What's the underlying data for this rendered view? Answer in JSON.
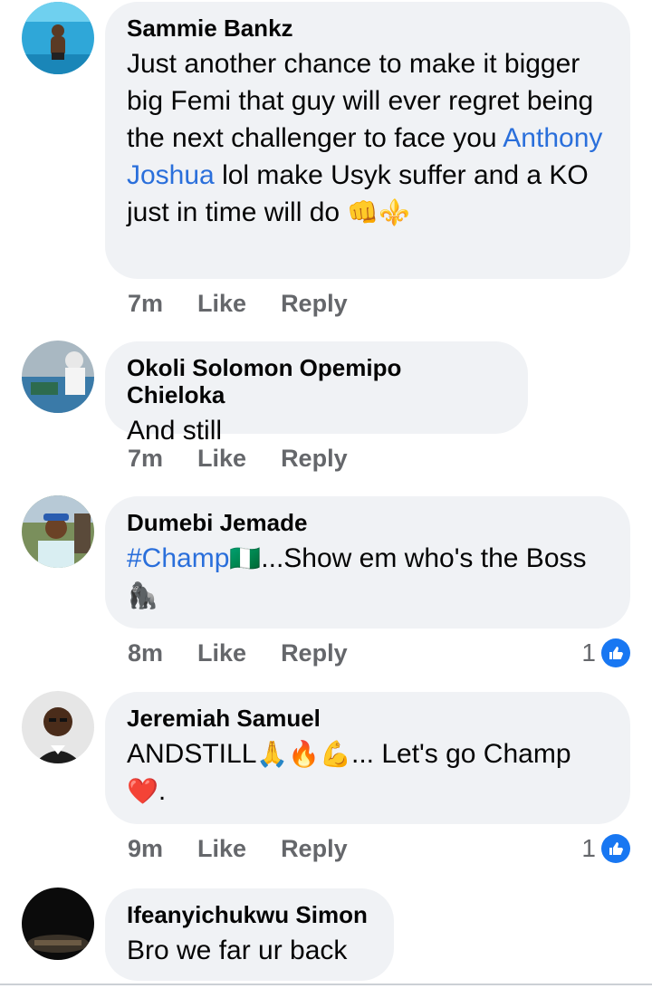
{
  "comments": [
    {
      "name": "Sammie Bankz",
      "text_a": "Just another chance to make it bigger big Femi that guy will ever regret being the next challenger to face you ",
      "mention": "Anthony Joshua",
      "text_b": " lol make Usyk suffer and a KO just in time will do ",
      "emoji": "👊⚜️",
      "time": "7m",
      "like": "Like",
      "reply": "Reply"
    },
    {
      "name": "Okoli Solomon Opemipo Chieloka",
      "text": "And still",
      "time": "7m",
      "like": "Like",
      "reply": "Reply"
    },
    {
      "name": "Dumebi Jemade",
      "hashtag": "#Champ",
      "text_a": "...Show em who's the Boss",
      "emoji_flag": "🇳🇬",
      "emoji_end": "🦍",
      "time": "8m",
      "like": "Like",
      "reply": "Reply",
      "reactions": "1"
    },
    {
      "name": "Jeremiah Samuel",
      "text_a": "ANDSTILL",
      "emoji_a": "🙏🔥💪",
      "text_b": "... Let's go Champ",
      "emoji_b": "❤️",
      "text_c": ".",
      "time": "9m",
      "like": "Like",
      "reply": "Reply",
      "reactions": "1"
    },
    {
      "name": "Ifeanyichukwu Simon",
      "text": "Bro we far ur back"
    }
  ],
  "colors": {
    "bubble": "#f0f2f5",
    "link": "#2a6fdb",
    "meta": "#65676b",
    "like_badge": "#1877f2"
  }
}
